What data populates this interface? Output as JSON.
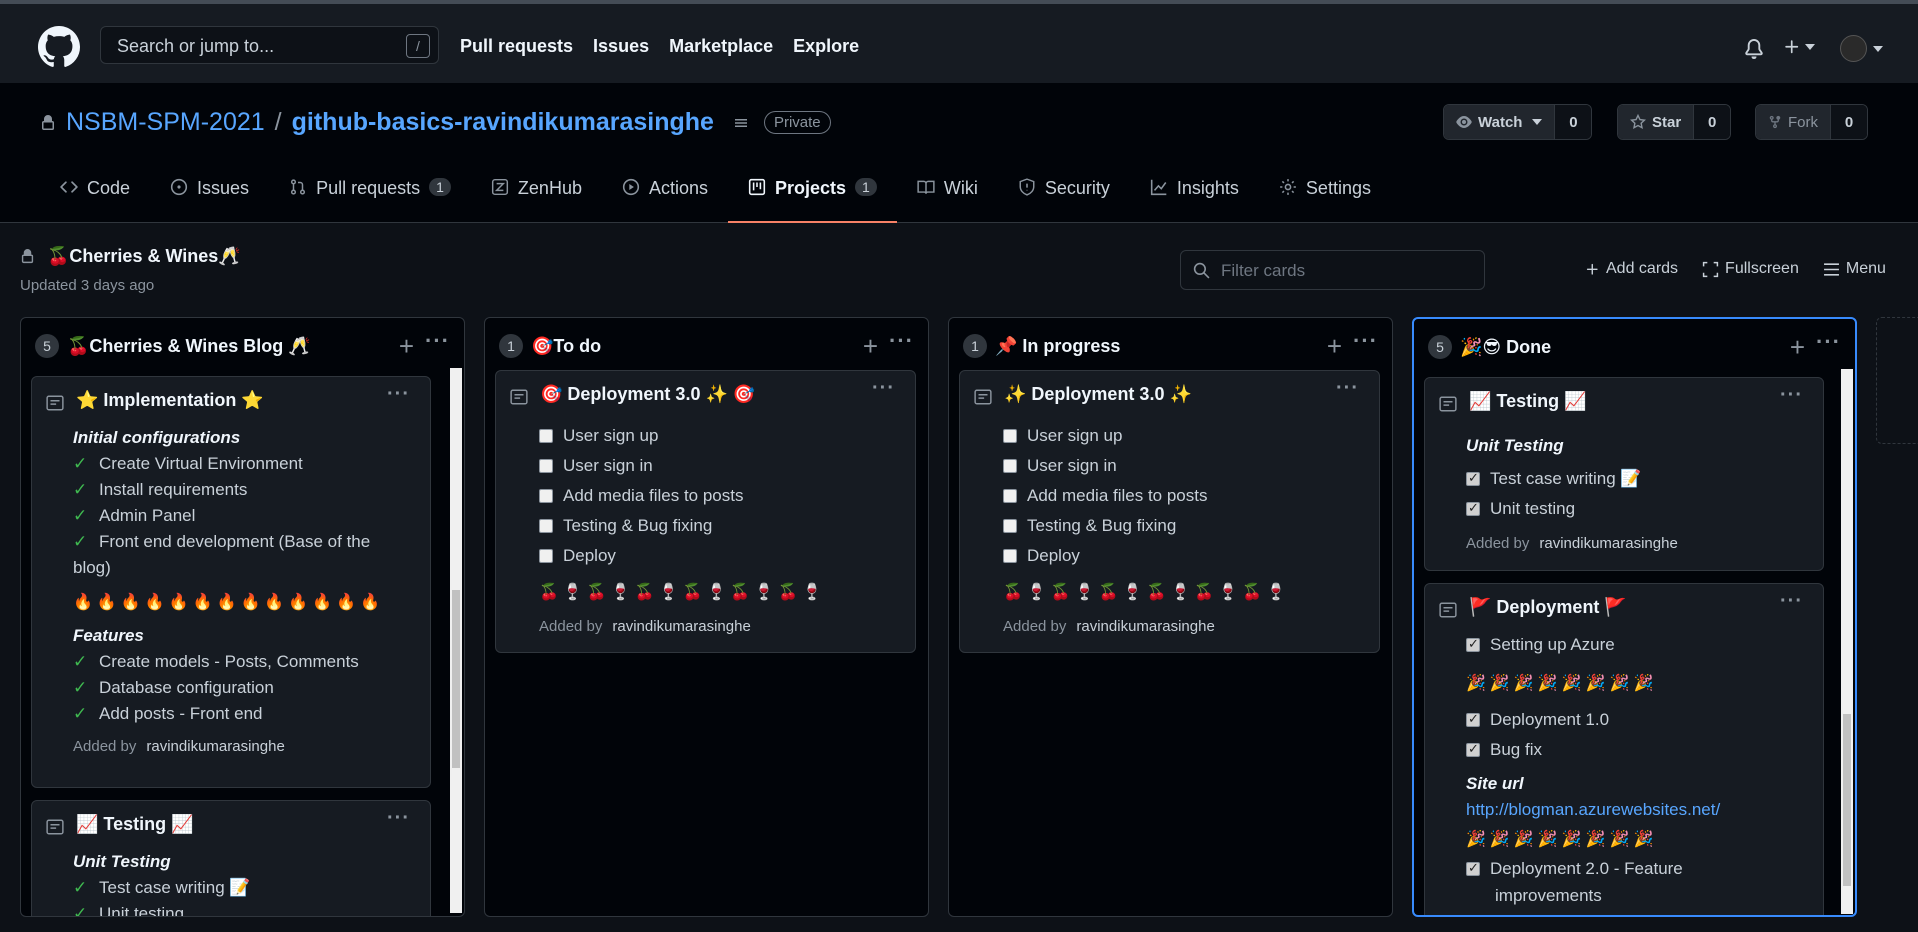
{
  "topbar": {
    "search_placeholder": "Search or jump to...",
    "slash_key": "/",
    "nav": [
      "Pull requests",
      "Issues",
      "Marketplace",
      "Explore"
    ]
  },
  "repo": {
    "owner": "NSBM-SPM-2021",
    "separator": "/",
    "name": "github-basics-ravindikumarasinghe",
    "visibility": "Private",
    "watch_label": "Watch",
    "watch_count": "0",
    "star_label": "Star",
    "star_count": "0",
    "fork_label": "Fork",
    "fork_count": "0"
  },
  "tabs": [
    {
      "label": "Code",
      "icon": "code-icon"
    },
    {
      "label": "Issues",
      "icon": "issue-icon"
    },
    {
      "label": "Pull requests",
      "icon": "pull-request-icon",
      "count": "1"
    },
    {
      "label": "ZenHub",
      "icon": "zenhub-icon"
    },
    {
      "label": "Actions",
      "icon": "play-icon"
    },
    {
      "label": "Projects",
      "icon": "project-icon",
      "count": "1",
      "selected": true
    },
    {
      "label": "Wiki",
      "icon": "book-icon"
    },
    {
      "label": "Security",
      "icon": "shield-icon"
    },
    {
      "label": "Insights",
      "icon": "graph-icon"
    },
    {
      "label": "Settings",
      "icon": "gear-icon"
    }
  ],
  "project": {
    "title": "🍒Cherries & Wines🥂",
    "updated": "Updated 3 days ago",
    "filter_placeholder": "Filter cards",
    "add_cards": "Add cards",
    "fullscreen": "Fullscreen",
    "menu": "Menu"
  },
  "columns": [
    {
      "count": "5",
      "title": "🍒Cherries & Wines Blog 🥂",
      "cards": [
        {
          "title": "⭐ Implementation ⭐",
          "section1": "Initial configurations",
          "items1": [
            "Create Virtual Environment",
            "Install requirements",
            "Admin Panel",
            "Front end development (Base of the",
            "blog)"
          ],
          "emoji_row": "🔥🔥🔥🔥🔥🔥🔥🔥🔥🔥🔥🔥🔥",
          "section2": "Features",
          "items2": [
            "Create models - Posts, Comments",
            "Database configuration",
            "Add posts - Front end"
          ],
          "added_prefix": "Added by",
          "added_by": "ravindikumarasinghe"
        },
        {
          "title": "📈 Testing 📈",
          "section1": "Unit Testing",
          "items1": [
            "Test case writing 📝",
            "Unit testing"
          ]
        }
      ]
    },
    {
      "count": "1",
      "title": "🎯To do",
      "cards": [
        {
          "title": "🎯 Deployment 3.0 ✨ 🎯",
          "items": [
            "User sign up",
            "User sign in",
            "Add media files to posts",
            "Testing & Bug fixing",
            "Deploy"
          ],
          "emoji_row": "🍒🍷🍒🍷🍒🍷🍒🍷🍒🍷🍒🍷",
          "added_prefix": "Added by",
          "added_by": "ravindikumarasinghe"
        }
      ]
    },
    {
      "count": "1",
      "title": "📌 In progress",
      "cards": [
        {
          "title": "✨ Deployment 3.0 ✨",
          "items": [
            "User sign up",
            "User sign in",
            "Add media files to posts",
            "Testing & Bug fixing",
            "Deploy"
          ],
          "emoji_row": "🍒🍷🍒🍷🍒🍷🍒🍷🍒🍷🍒🍷",
          "added_prefix": "Added by",
          "added_by": "ravindikumarasinghe"
        }
      ]
    },
    {
      "count": "5",
      "title": "🎉😎 Done",
      "cards": [
        {
          "title": "📈 Testing 📈",
          "section1": "Unit Testing",
          "items": [
            "Test case writing 📝",
            "Unit testing"
          ],
          "added_prefix": "Added by",
          "added_by": "ravindikumarasinghe"
        },
        {
          "title": "🚩 Deployment 🚩",
          "item_a": "Setting up Azure",
          "emoji_row": "🎉🎉🎉🎉🎉🎉🎉🎉",
          "items_b": [
            "Deployment 1.0",
            "Bug fix"
          ],
          "section": "Site url",
          "url": "http://blogman.azurewebsites.net/",
          "emoji_row2": "🎉🎉🎉🎉🎉🎉🎉🎉",
          "item_c1": "Deployment 2.0 - Feature",
          "item_c2": "improvements"
        }
      ]
    }
  ],
  "colors": {
    "accent": "#58a6ff",
    "tab_underline": "#f78166",
    "check_green": "#3fb950",
    "active_column_border": "#388bfd"
  }
}
